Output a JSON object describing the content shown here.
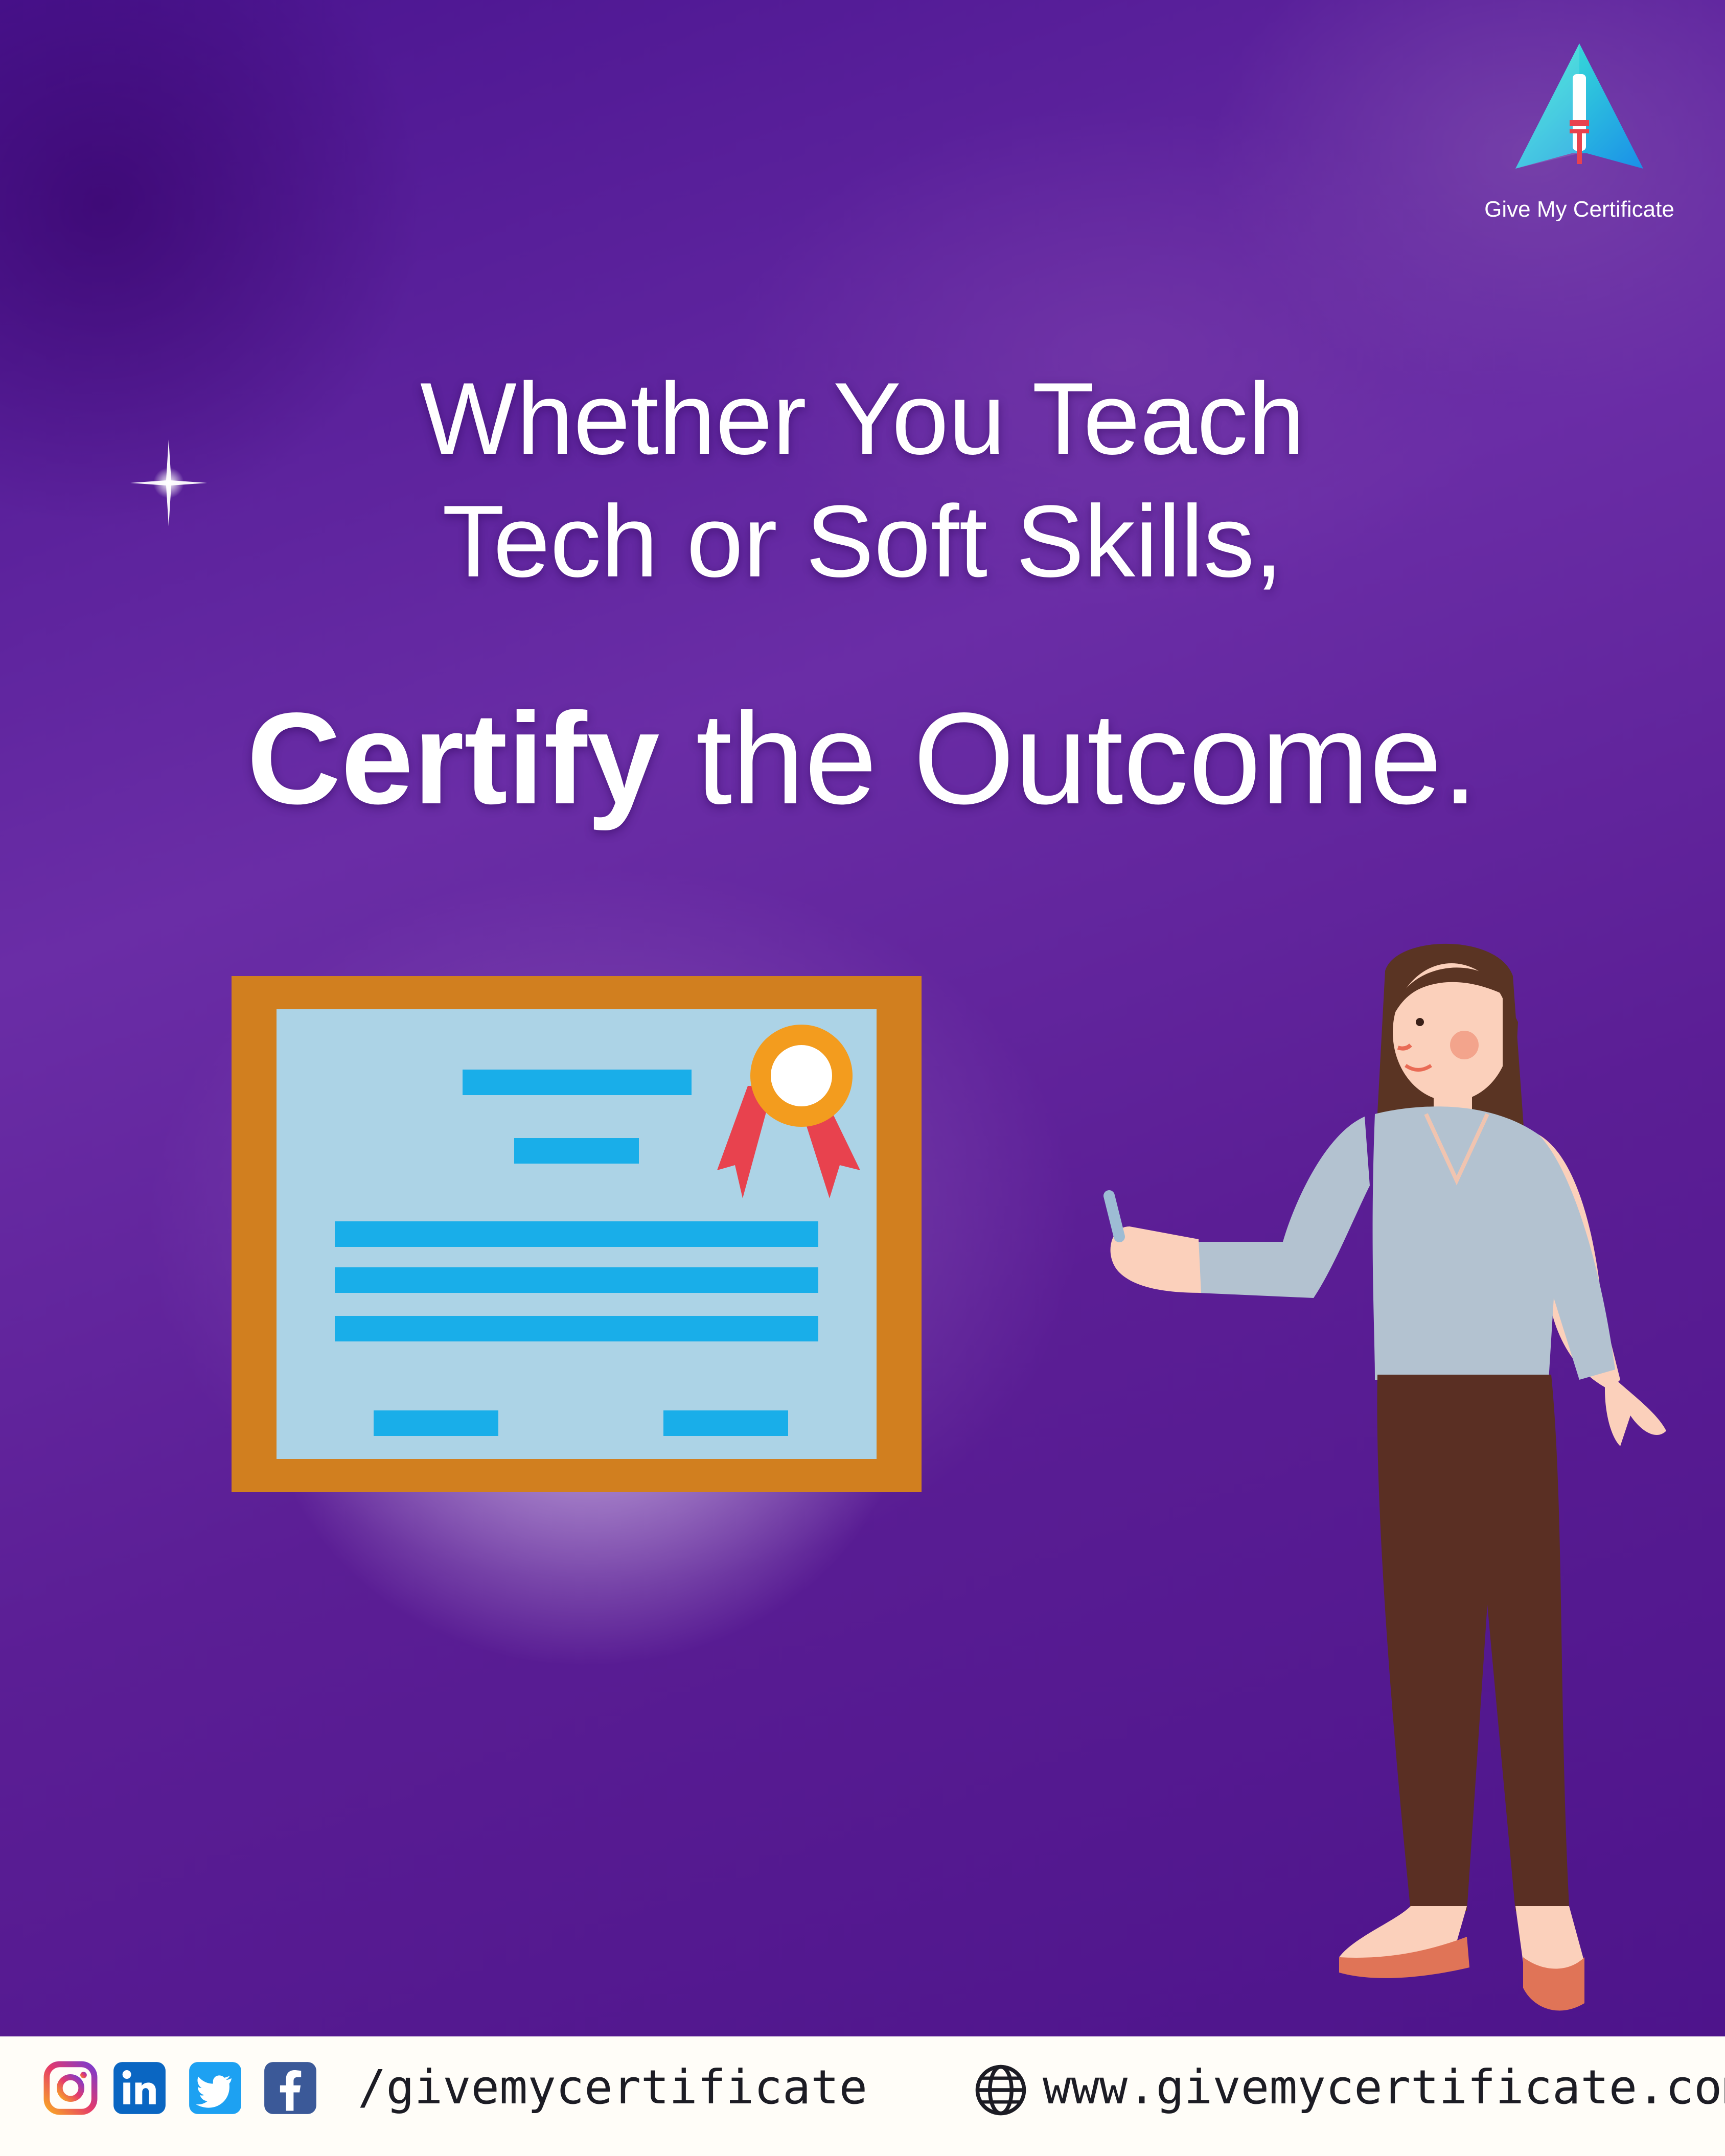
{
  "brand": {
    "name": "Give My Certificate",
    "logo_icon": "paper-plane-scroll-icon",
    "colors": {
      "teal": "#2ee6d6",
      "blue": "#1da1f2",
      "red": "#e8424e"
    }
  },
  "headline": {
    "line1": "Whether You Teach",
    "line2": "Tech or Soft Skills,",
    "emphasis": "Certify",
    "rest": " the Outcome."
  },
  "illustrations": {
    "certificate": "certificate-with-ribbon",
    "person": "woman-presenting-with-chalk"
  },
  "footer": {
    "social_icons": [
      "instagram-icon",
      "linkedin-icon",
      "twitter-icon",
      "facebook-icon"
    ],
    "handle": "/givemycertificate",
    "website_icon": "globe-icon",
    "website": "www.givemycertificate.com"
  },
  "colors": {
    "background": "#5b1e95",
    "certificate_frame": "#d17f1f",
    "certificate_paper": "#acd3e6",
    "certificate_lines": "#19aee9",
    "footer_bg": "#fffdf8"
  }
}
